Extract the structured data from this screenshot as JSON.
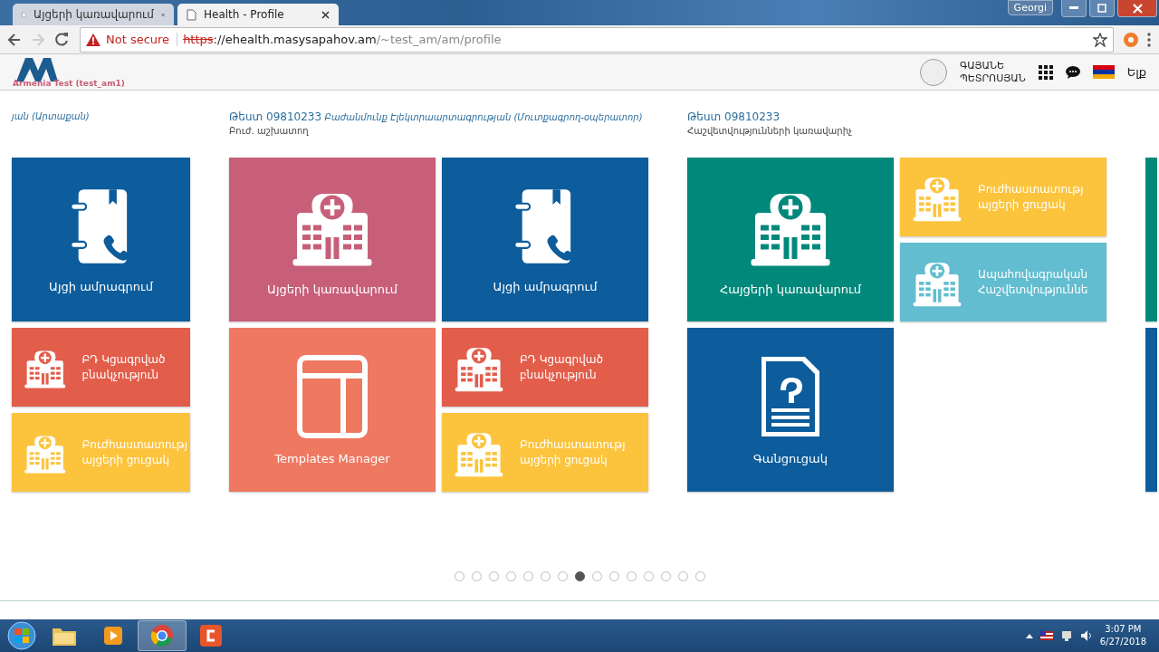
{
  "browser": {
    "tabs": [
      {
        "title": "Այցերի կառավարում",
        "selected": false
      },
      {
        "title": "Health - Profile",
        "selected": true
      }
    ],
    "profile_badge": "Georgi",
    "forward_disabled": true,
    "security": "Not secure",
    "url": {
      "scheme": "https",
      "host": "://ehealth.masysapahov.am",
      "path": "/~test_am/am/profile"
    }
  },
  "header": {
    "org": "Armenia Test (test_am1)",
    "user_name": "ԳԱՅԱՆԵ ՊԵՏՐՈՍՅԱՆ",
    "logout": "Ելք"
  },
  "groups": [
    {
      "kind": "cut-left",
      "role": "յան (Արտաքան)",
      "columns": [
        [
          {
            "kind": "notebook",
            "color": "#0d5c9b",
            "label": "Այցի ամրագրում"
          },
          {
            "kind": "row",
            "color": "#e35d4b",
            "label": "ԲԴ Կցագրված բնակչություն"
          },
          {
            "kind": "row",
            "color": "#fcc43d",
            "label": "Բուժհաստատությ այցերի ցուցակ"
          }
        ]
      ]
    },
    {
      "kind": "full",
      "title": "Թեստ 09810233",
      "role": "Բաժանմունք Էլեկտրաարտագրության (Մուտքագրող-օպերատոր)",
      "subtitle": "Բուժ. աշխատող",
      "columns": [
        [
          {
            "kind": "hospital",
            "color": "#c75f78",
            "label": "Այցերի կառավարում"
          },
          {
            "kind": "template",
            "color": "#ef7861",
            "label": "Templates Manager"
          }
        ],
        [
          {
            "kind": "notebook",
            "color": "#0d5c9b",
            "label": "Այցի ամրագրում"
          },
          {
            "kind": "row",
            "color": "#e35d4b",
            "label": "ԲԴ Կցագրված բնակչություն"
          },
          {
            "kind": "row",
            "color": "#fcc43d",
            "label": "Բուժհաստատությ այցերի ցուցակ"
          }
        ]
      ]
    },
    {
      "kind": "full",
      "title": "Թեստ 09810233",
      "subtitle": "Հաշվետվությունների կառավարիչ",
      "columns": [
        [
          {
            "kind": "hospital",
            "color": "#00897b",
            "label": "Հայցերի կառավարում"
          },
          {
            "kind": "document",
            "color": "#0d5c9b",
            "label": "Գանցուցակ"
          }
        ],
        [
          {
            "kind": "row",
            "color": "#fcc43d",
            "label": "Բուժհաստատությ այցերի ցուցակ"
          },
          {
            "kind": "row",
            "color": "#63bdd0",
            "label": "Ապահովագրական Հաշվետվություննե"
          }
        ]
      ]
    },
    {
      "kind": "cut-right",
      "columns": [
        [
          {
            "kind": "edge",
            "color": "#00897b"
          },
          {
            "kind": "edge",
            "color": "#0d5c9b"
          }
        ]
      ]
    }
  ],
  "pager": [
    {
      "selected": false
    },
    {
      "selected": false
    },
    {
      "selected": false
    },
    {
      "selected": false
    },
    {
      "selected": false
    },
    {
      "selected": false
    },
    {
      "selected": false
    },
    {
      "selected": true
    },
    {
      "selected": false
    },
    {
      "selected": false
    },
    {
      "selected": false
    },
    {
      "selected": false
    },
    {
      "selected": false
    },
    {
      "selected": false
    },
    {
      "selected": false
    }
  ],
  "taskbar": {
    "apps": [
      {
        "kind": "folder",
        "selected": false
      },
      {
        "kind": "media",
        "selected": false
      },
      {
        "kind": "browser",
        "selected": true
      },
      {
        "kind": "orange",
        "selected": false
      }
    ],
    "time": "3:07 PM",
    "date": "6/27/2018"
  }
}
